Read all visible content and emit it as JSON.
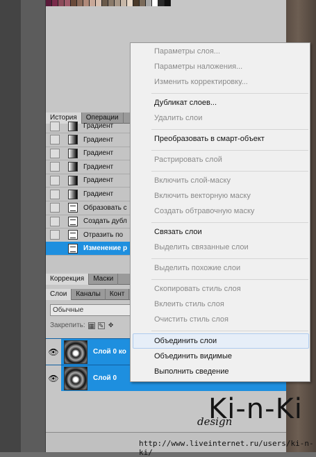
{
  "swatch_colors": [
    "#5a1a3a",
    "#7a2a4a",
    "#8c4a5a",
    "#a05a6a",
    "#6a4a3a",
    "#8a6a5a",
    "#b08a7a",
    "#c8a898",
    "#d8c0b0",
    "#6a5a4a",
    "#8a7a6a",
    "#a89888",
    "#c8b8a8",
    "#e8d8c8",
    "#4a3a2a",
    "#7a6a5a",
    "#a8a8a8",
    "#ffffff",
    "#2a2a2a",
    "#111111"
  ],
  "history_panel": {
    "tabs": [
      "История",
      "Операции"
    ],
    "items": [
      {
        "label": "Градиент",
        "icon": "gradient-icon"
      },
      {
        "label": "Градиент",
        "icon": "gradient-icon"
      },
      {
        "label": "Градиент",
        "icon": "gradient-icon"
      },
      {
        "label": "Градиент",
        "icon": "gradient-icon"
      },
      {
        "label": "Градиент",
        "icon": "gradient-icon"
      },
      {
        "label": "Градиент",
        "icon": "gradient-icon"
      },
      {
        "label": "Образовать с",
        "icon": "document-icon"
      },
      {
        "label": "Создать дубл",
        "icon": "document-icon"
      },
      {
        "label": "Отразить по",
        "icon": "document-icon"
      },
      {
        "label": "Изменение р",
        "icon": "document-icon",
        "selected": true
      }
    ]
  },
  "adjust_tabs": [
    "Коррекция",
    "Маски"
  ],
  "layers_panel": {
    "tabs": [
      "Слои",
      "Каналы",
      "Конт"
    ],
    "blend_mode": "Обычные",
    "lock_label": "Закрепить:",
    "layers": [
      {
        "name": "Слой 0 ко"
      },
      {
        "name": "Слой 0"
      }
    ]
  },
  "context_menu": {
    "items": [
      {
        "label": "Параметры слоя...",
        "enabled": false
      },
      {
        "label": "Параметры наложения...",
        "enabled": false
      },
      {
        "label": "Изменить корректировку...",
        "enabled": false
      },
      {
        "label": "Дубликат слоев...",
        "enabled": true
      },
      {
        "label": "Удалить слои",
        "enabled": false
      },
      {
        "label": "Преобразовать в смарт-объект",
        "enabled": true
      },
      {
        "label": "Растрировать слой",
        "enabled": false
      },
      {
        "label": "Включить слой-маску",
        "enabled": false
      },
      {
        "label": "Включить векторную маску",
        "enabled": false
      },
      {
        "label": "Создать обтравочную маску",
        "enabled": false
      },
      {
        "label": "Связать слои",
        "enabled": true
      },
      {
        "label": "Выделить связанные слои",
        "enabled": false
      },
      {
        "label": "Выделить похожие слои",
        "enabled": false
      },
      {
        "label": "Скопировать стиль слоя",
        "enabled": false
      },
      {
        "label": "Вклеить стиль слоя",
        "enabled": false
      },
      {
        "label": "Очистить стиль слоя",
        "enabled": false
      },
      {
        "label": "Объединить слои",
        "enabled": true,
        "highlighted": true
      },
      {
        "label": "Объединить видимые",
        "enabled": true
      },
      {
        "label": "Выполнить сведение",
        "enabled": true
      }
    ]
  },
  "watermark": {
    "brand": "Ki-n-Ki",
    "design": "design",
    "url": "http://www.liveinternet.ru/users/ki-n-ki/"
  }
}
